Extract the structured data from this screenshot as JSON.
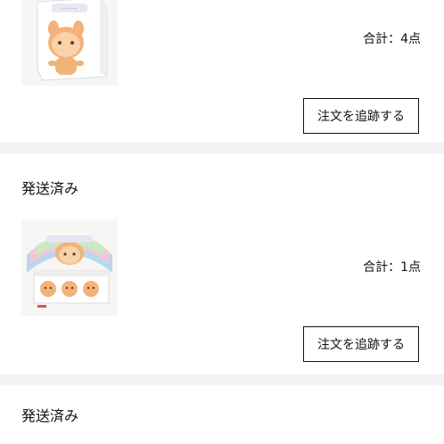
{
  "orders": [
    {
      "status": "",
      "total_text": "合計：4点",
      "track_button": "注文を追跡する",
      "thumbnail_icon": "blind-box-product-image"
    },
    {
      "status": "発送済み",
      "total_text": "合計：1点",
      "track_button": "注文を追跡する",
      "thumbnail_icon": "blind-box-display-set-image"
    },
    {
      "status": "発送済み"
    }
  ],
  "colors": {
    "page_bg": "#f2f2f2",
    "card_bg": "#ffffff",
    "text": "#111111",
    "button_border": "#111111"
  }
}
